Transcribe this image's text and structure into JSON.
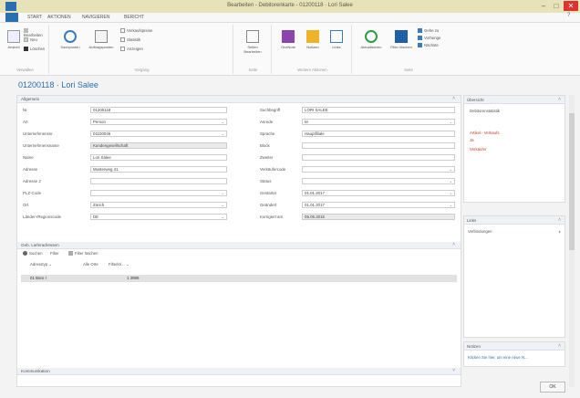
{
  "window": {
    "title": "Bearbeiten - Debitorenkarte - 01200118 · Lori Salee",
    "minimize": "–",
    "maximize": "□",
    "close": "✕"
  },
  "tabs": [
    "START",
    "AKTIONEN",
    "NAVIGIEREN",
    "BERICHT"
  ],
  "ribbon": {
    "groups": [
      {
        "label": "Verwalten",
        "big": "Ansicht",
        "small": [
          "Bearbeiten",
          "Neu",
          "Löschen"
        ]
      },
      {
        "label": "Vorgang",
        "big1": "Sachposten",
        "big2": "Auftragsposten",
        "small": [
          "Verkaufspreise",
          "Statistik",
          "Anzeigen"
        ]
      },
      {
        "label": "Seite",
        "big": "Seiten Bearbeiten"
      },
      {
        "label": "Weitere Aktionen",
        "big": [
          "OneNote",
          "Notizen",
          "Links"
        ]
      },
      {
        "label": "Seite",
        "big": [
          "Aktualisieren",
          "Filter löschen"
        ],
        "small": [
          "Gehe zu",
          "Vorherige",
          "Nächste"
        ]
      }
    ]
  },
  "page_title": "01200118 · Lori Salee",
  "general": {
    "header": "Allgemein",
    "left": [
      {
        "label": "Nr.",
        "value": "01200118",
        "ro": false,
        "dd": false
      },
      {
        "label": "Art",
        "value": "Person",
        "ro": false,
        "dd": true
      },
      {
        "label": "Unternehmensnr.",
        "value": "01100046",
        "ro": false,
        "dd": true
      },
      {
        "label": "Unternehmensname",
        "value": "Kundengesellschaft",
        "ro": true,
        "dd": false
      },
      {
        "label": "Name",
        "value": "Lori Salee",
        "ro": false,
        "dd": false
      },
      {
        "label": "Adresse",
        "value": "Musterweg 41",
        "ro": false,
        "dd": false
      },
      {
        "label": "Adresse 2",
        "value": "",
        "ro": false,
        "dd": false
      },
      {
        "label": "PLZ-Code",
        "value": "",
        "ro": false,
        "dd": true
      },
      {
        "label": "Ort",
        "value": "Zürich",
        "ro": false,
        "dd": true
      },
      {
        "label": "Länder-/Regionscode",
        "value": "DE",
        "ro": false,
        "dd": true
      }
    ],
    "right": [
      {
        "label": "Suchbegriff",
        "value": "LORI SALEE",
        "ro": false,
        "dd": false
      },
      {
        "label": "Anrede",
        "value": "M",
        "ro": false,
        "dd": true
      },
      {
        "label": "Sprache",
        "value": "Hauptfiliale",
        "ro": false,
        "dd": false
      },
      {
        "label": "Block",
        "value": "",
        "ro": false,
        "dd": false
      },
      {
        "label": "Zweiter",
        "value": "",
        "ro": false,
        "dd": false
      },
      {
        "label": "Verkäufercode",
        "value": "",
        "ro": false,
        "dd": true
      },
      {
        "label": "Status",
        "value": "",
        "ro": false,
        "dd": true
      },
      {
        "label": "Gestartet",
        "value": "01.01.2017",
        "ro": false,
        "dd": true
      },
      {
        "label": "Geändert",
        "value": "01.01.2017",
        "ro": false,
        "dd": true
      },
      {
        "label": "Korrigiert am",
        "value": "05.05.2015",
        "ro": true,
        "dd": false
      }
    ]
  },
  "sub": {
    "header": "Geb. Lieferadressen",
    "actions": [
      "Suchen",
      "Filter",
      "Filter löschen"
    ],
    "filter_left": "Adresstyp",
    "filter_right": "Alle Orte",
    "filter_val": "Filterkri...",
    "row_left": "01 Büro I",
    "row_right": "1 3999"
  },
  "bottom_header": "Kommunikation",
  "factboxes": [
    {
      "header": "Übersicht",
      "items": [
        "Debitorenstatistik",
        "",
        "Artikel - Verkaufs",
        "Ja",
        "Verkäufer"
      ]
    },
    {
      "header": "Links",
      "items": [
        "Verbindungen"
      ]
    },
    {
      "header": "Notizen",
      "items": [
        "Klicken Sie hier, um eine neue N..."
      ]
    }
  ],
  "ok": "OK",
  "colors": {
    "accent": "#2a6fb0",
    "titlebar": "#e8e2b8",
    "red": "#c0392b"
  }
}
